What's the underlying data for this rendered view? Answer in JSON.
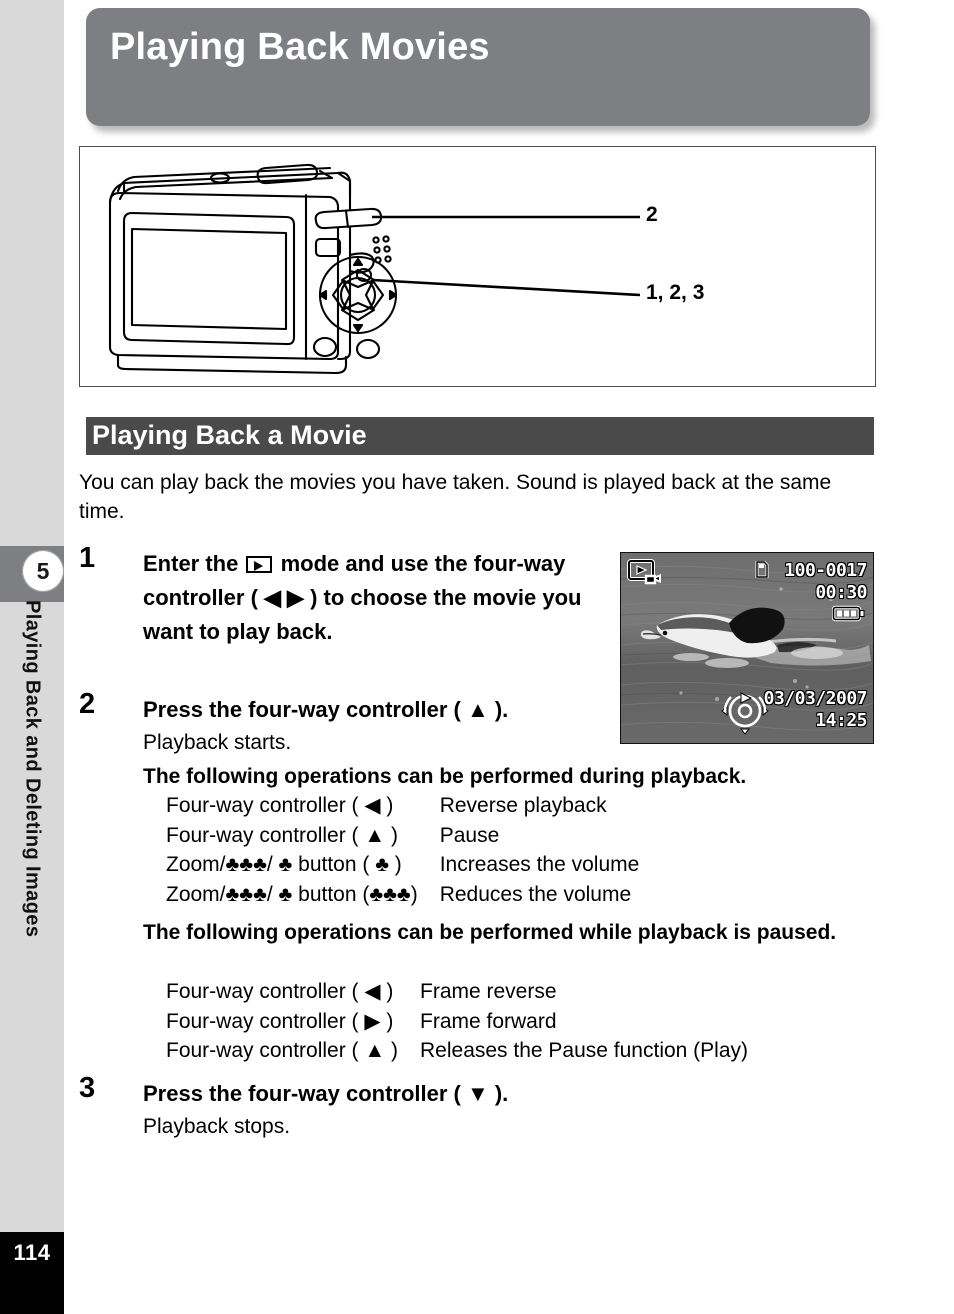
{
  "page": {
    "title": "Playing Back Movies",
    "number": "114",
    "chapter_number": "5",
    "chapter_label": "Playing Back and Deleting Images"
  },
  "diagram": {
    "callouts": [
      {
        "id": "callout-2",
        "label": "2"
      },
      {
        "id": "callout-123",
        "label": "1, 2, 3"
      }
    ],
    "alt": "Rear view of compact digital camera showing zoom button and four-way controller"
  },
  "section": {
    "title": "Playing Back a Movie",
    "intro": "You can play back the movies you have taken. Sound is played back at the same time."
  },
  "steps": [
    {
      "number": "1",
      "text_before_icon": "Enter the ",
      "icon": "playback-mode-icon",
      "text_after_icon": " mode and use the four-way controller ( ◀ ▶ ) to choose the movie you want to play back."
    },
    {
      "number": "2",
      "text": "Press the four-way controller ( ▲ ).",
      "note": "Playback starts."
    },
    {
      "number": "3",
      "text": "Press the four-way controller ( ▼ ).",
      "note": "Playback stops."
    }
  ],
  "during_playback": {
    "heading": "The following operations can be performed during playback.",
    "rows": [
      {
        "key": "Four-way controller ( ◀ )",
        "value": "Reverse playback"
      },
      {
        "key": "Four-way controller ( ▲ )",
        "value": "Pause"
      },
      {
        "key": "Zoom/♣♣♣/ ♣  button ( ♣ )",
        "value": "Increases the volume"
      },
      {
        "key": "Zoom/♣♣♣/ ♣  button (♣♣♣)",
        "value": "Reduces the volume"
      }
    ]
  },
  "while_paused": {
    "heading": "The following operations can be performed while playback is paused.",
    "rows": [
      {
        "key": "Four-way controller ( ◀ )",
        "value": "Frame reverse"
      },
      {
        "key": "Four-way controller ( ▶ )",
        "value": "Frame forward"
      },
      {
        "key": "Four-way controller ( ▲ )",
        "value": "Releases the Pause function (Play)"
      }
    ]
  },
  "lcd_screen": {
    "file_number": "100-0017",
    "duration": "00:30",
    "date": "03/03/2007",
    "time": "14:25",
    "mode_icon": "movie-playback-icon",
    "battery_icon": "battery-full-icon",
    "controller_guide_icon": "four-way-controller-guide-icon",
    "photo_subject": "dolphin swimming in water"
  },
  "colors": {
    "header_banner": "#7d7f82",
    "section_bar": "#4a4a4a",
    "sidebar": "#d9d9d9",
    "page_number_block": "#000000"
  }
}
